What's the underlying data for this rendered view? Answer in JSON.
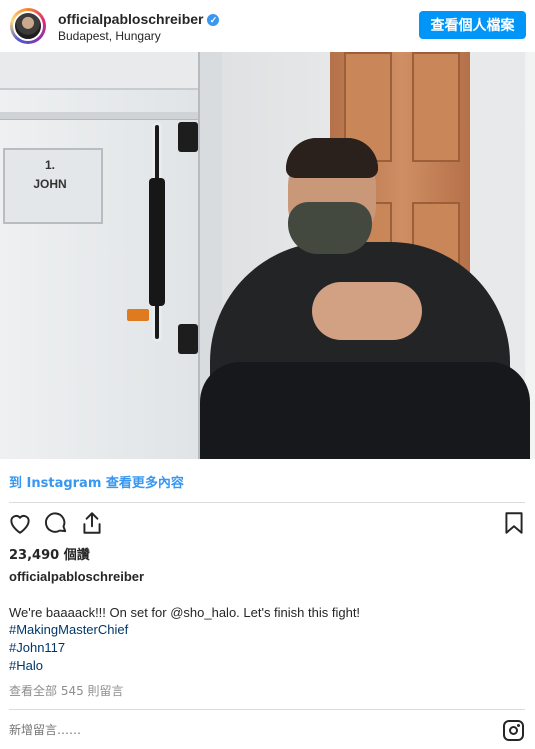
{
  "header": {
    "username": "officialpabloschreiber",
    "location": "Budapest, Hungary",
    "verified_icon": "verified-badge-icon",
    "profile_button_label": "查看個人檔案"
  },
  "photo": {
    "sign_line1": "1.",
    "sign_line2": "JOHN"
  },
  "post": {
    "instagram_link": "到 Instagram 查看更多內容",
    "likes": "23,490 個讚",
    "caption_username": "officialpabloschreiber",
    "caption_text": "We're baaaack!!! On set for @sho_halo. Let's finish this fight!",
    "hashtags": [
      "#MakingMasterChief",
      "#John117",
      "#Halo"
    ],
    "view_comments": "查看全部 545 則留言",
    "comment_placeholder": "新增留言……"
  },
  "icons": {
    "like": "heart-icon",
    "comment": "comment-icon",
    "share": "share-icon",
    "save": "bookmark-icon",
    "instagram": "instagram-logo-icon"
  },
  "colors": {
    "accent": "#0095f6",
    "link": "#3897f0",
    "hashtag": "#00376b",
    "muted": "#8e8e8e",
    "text": "#262626"
  }
}
